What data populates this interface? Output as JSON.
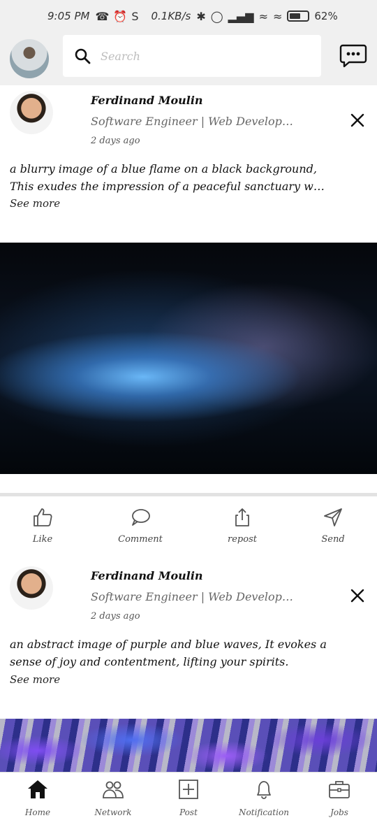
{
  "status_bar": {
    "time": "9:05 PM",
    "network_speed": "0.1KB/s",
    "battery": "62%",
    "battery_level": 0.62
  },
  "search": {
    "placeholder": "Search"
  },
  "icons": {
    "messages": "chat-dots-icon",
    "search": "search-icon",
    "close": "close-icon"
  },
  "posts": [
    {
      "author": "Ferdinand Moulin",
      "headline": "Software Engineer | Web Develop…",
      "time": "2 days ago",
      "text_line1": "a blurry image of a blue flame on a black background,",
      "text_line2": "This exudes the impression of a peaceful sanctuary w…",
      "see_more": "See more"
    },
    {
      "author": "Ferdinand Moulin",
      "headline": "Software Engineer | Web Develop…",
      "time": "2 days ago",
      "text_line1": "an abstract image of purple and blue waves, It evokes a",
      "text_line2": "sense of joy and contentment, lifting your spirits.",
      "see_more": "See more"
    }
  ],
  "actions": {
    "like": "Like",
    "comment": "Comment",
    "repost": "repost",
    "send": "Send"
  },
  "bottom_nav": {
    "home": "Home",
    "network": "Network",
    "post": "Post",
    "notification": "Notification",
    "jobs": "Jobs"
  }
}
